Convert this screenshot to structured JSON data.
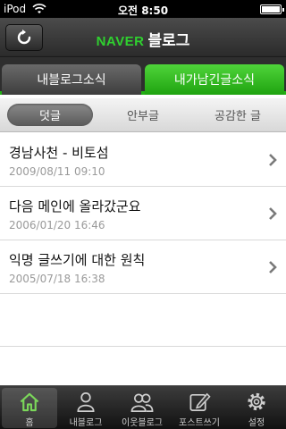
{
  "status_bar": {
    "carrier": "iPod",
    "time": "오전 8:50"
  },
  "nav": {
    "brand": "NAVER",
    "title": "블로그",
    "refresh_icon": "refresh-icon"
  },
  "tabs": [
    {
      "label": "내블로그소식",
      "active": false
    },
    {
      "label": "내가남긴글소식",
      "active": true
    }
  ],
  "segments": [
    {
      "label": "덧글",
      "selected": true
    },
    {
      "label": "안부글",
      "selected": false
    },
    {
      "label": "공감한 글",
      "selected": false
    }
  ],
  "items": [
    {
      "title": "경남사천 -  비토섬",
      "date": "2009/08/11 09:10"
    },
    {
      "title": "다음 메인에 올라갔군요",
      "date": "2006/01/20 16:46"
    },
    {
      "title": "익명 글쓰기에 대한 원칙",
      "date": "2005/07/18 16:38"
    }
  ],
  "tabbar": [
    {
      "label": "홈",
      "icon": "home-icon",
      "selected": true
    },
    {
      "label": "내블로그",
      "icon": "person-icon",
      "selected": false
    },
    {
      "label": "이웃블로그",
      "icon": "people-icon",
      "selected": false
    },
    {
      "label": "포스트쓰기",
      "icon": "pencil-icon",
      "selected": false
    },
    {
      "label": "설정",
      "icon": "gear-icon",
      "selected": false
    }
  ],
  "colors": {
    "accent_green": "#22b014",
    "brand_green": "#2fd02f",
    "home_icon_green": "#7bd85a"
  }
}
